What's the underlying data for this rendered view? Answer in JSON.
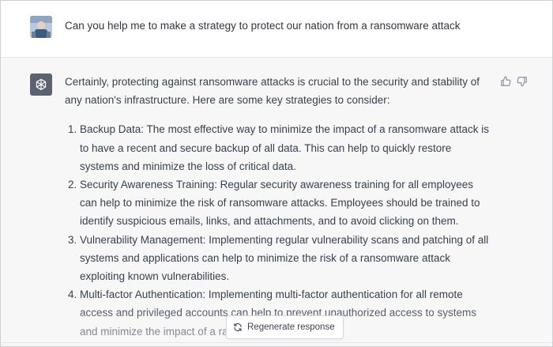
{
  "user_message": {
    "text": "Can you help me to make a strategy to protect our nation from a ransomware attack"
  },
  "assistant_message": {
    "intro": "Certainly, protecting against ransomware attacks is crucial to the security and stability of any nation's infrastructure. Here are some key strategies to consider:",
    "items": [
      "Backup Data: The most effective way to minimize the impact of a ransomware attack is to have a recent and secure backup of all data. This can help to quickly restore systems and minimize the loss of critical data.",
      "Security Awareness Training: Regular security awareness training for all employees can help to minimize the risk of ransomware attacks. Employees should be trained to identify suspicious emails, links, and attachments, and to avoid clicking on them.",
      "Vulnerability Management: Implementing regular vulnerability scans and patching of all systems and applications can help to minimize the risk of a ransomware attack exploiting known vulnerabilities.",
      "Multi-factor Authentication: Implementing multi-factor authentication for all remote access and privileged accounts can help to prevent unauthorized access to systems and minimize the impact of a ransomware attack."
    ]
  },
  "regenerate": {
    "label": "Regenerate response",
    "icon": "refresh-icon"
  },
  "feedback": {
    "up_icon": "thumbs-up-icon",
    "down_icon": "thumbs-down-icon"
  },
  "colors": {
    "assistant_bg": "#f7f7f8",
    "gpt_avatar": "#5b6270",
    "text": "#374151"
  }
}
